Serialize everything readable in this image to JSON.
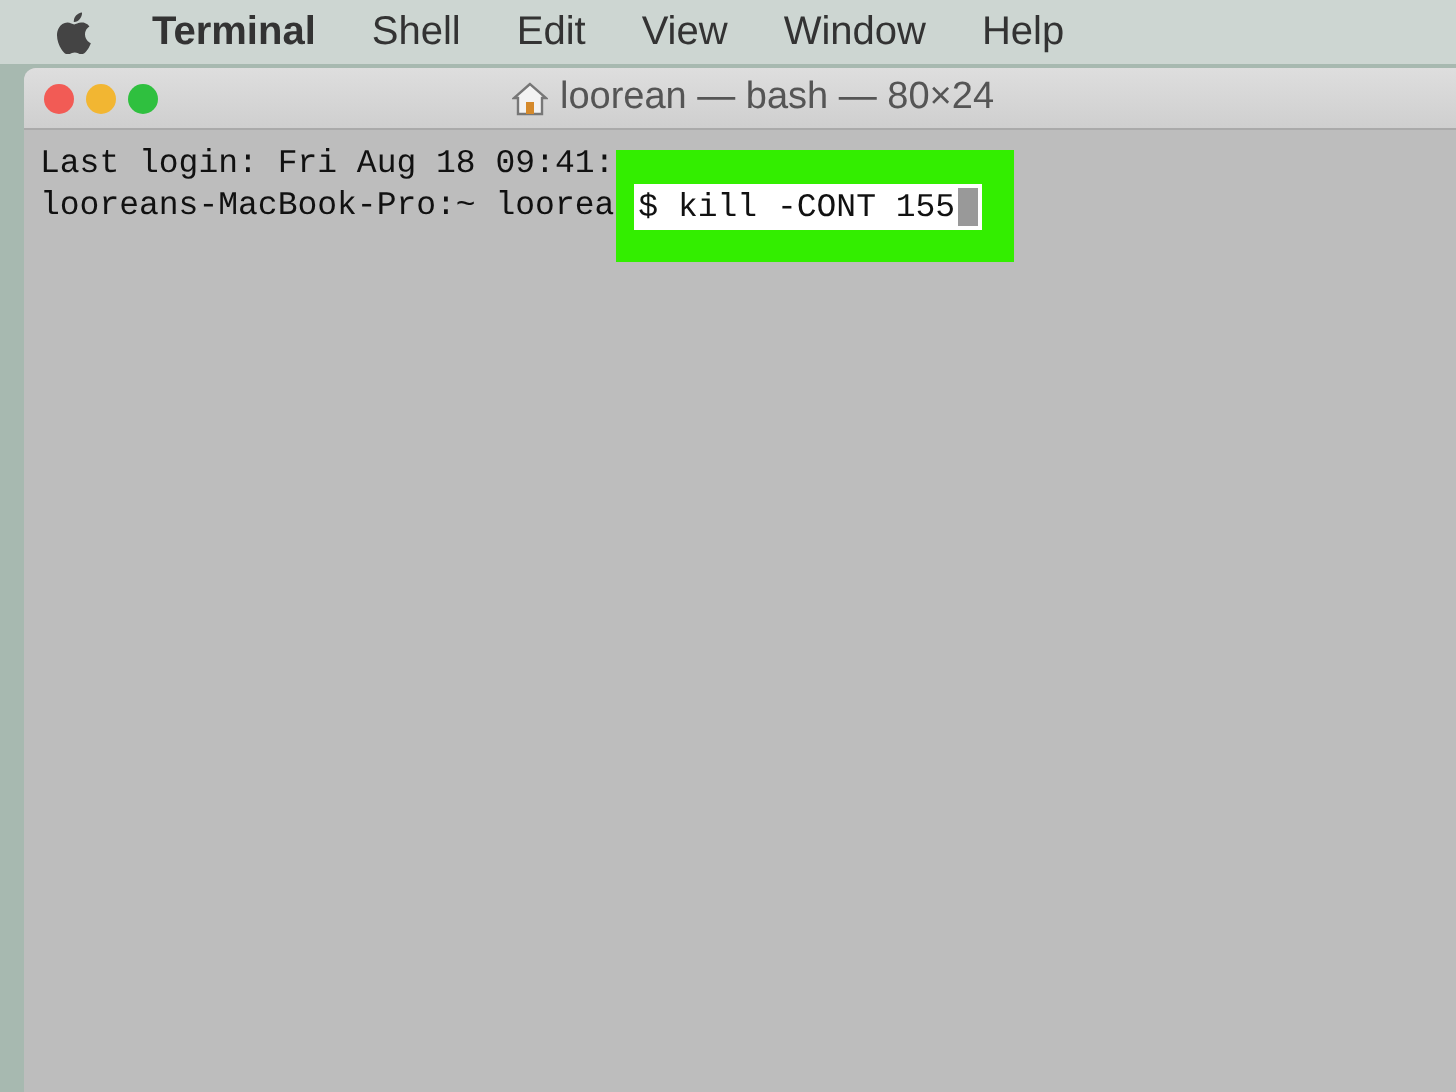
{
  "menu_bar": {
    "items": [
      {
        "label": "Terminal",
        "kind": "app"
      },
      {
        "label": "Shell",
        "kind": "menu"
      },
      {
        "label": "Edit",
        "kind": "menu"
      },
      {
        "label": "View",
        "kind": "menu"
      },
      {
        "label": "Window",
        "kind": "menu"
      },
      {
        "label": "Help",
        "kind": "menu"
      }
    ]
  },
  "window": {
    "title": "loorean — bash — 80×24"
  },
  "terminal": {
    "lines": [
      "Last login: Fri Aug 18 09:41:",
      "looreans-MacBook-Pro:~ loorea"
    ],
    "command": "$ kill -CONT 155"
  }
}
